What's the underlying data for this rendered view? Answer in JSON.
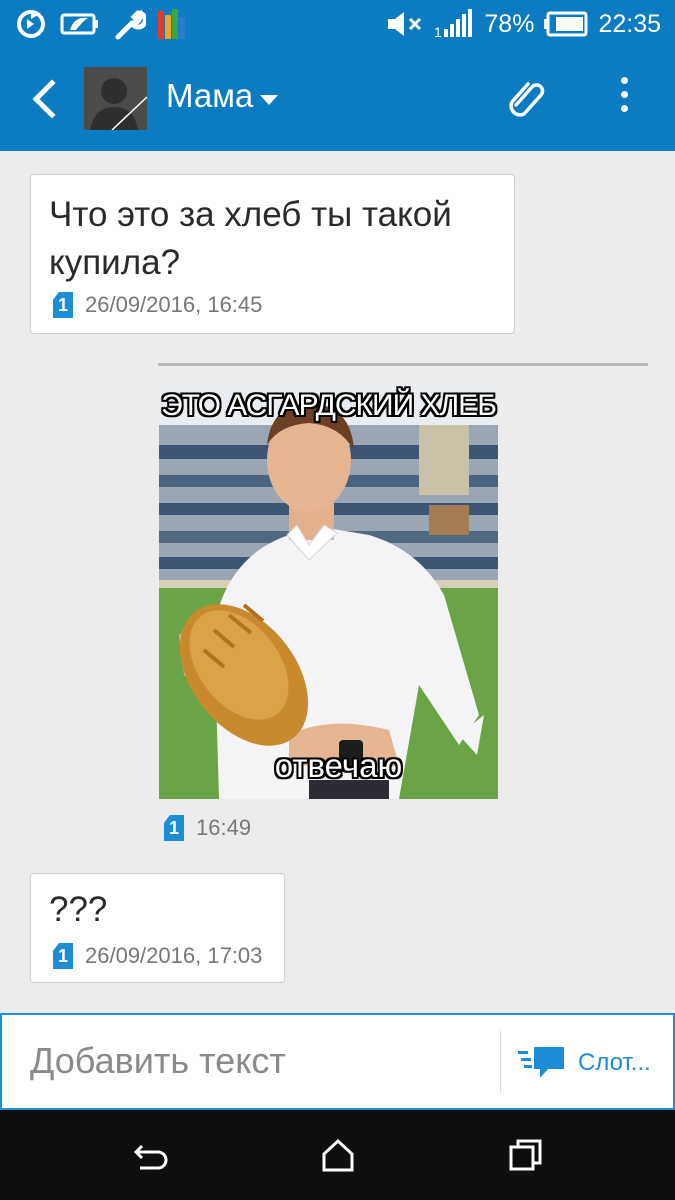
{
  "status_bar": {
    "battery": "78%",
    "time": "22:35",
    "icons": [
      "sync-icon",
      "battery-saver-icon",
      "wrench-icon",
      "avg-antivirus-icon",
      "mute-icon",
      "signal-icon",
      "battery-icon"
    ]
  },
  "app_bar": {
    "contact_name": "Мама",
    "back_icon": "back-arrow-icon",
    "attach_icon": "paperclip-icon",
    "menu_icon": "more-vertical-icon"
  },
  "messages": [
    {
      "text": "Что это за хлеб ты такой купила?",
      "sim": "1",
      "timestamp": "26/09/2016, 16:45"
    },
    {
      "type": "image",
      "caption_top": "ЭТО АСГАРДСКИЙ ХЛЕБ",
      "caption_bottom": "отвечаю",
      "sim": "1",
      "timestamp": "16:49"
    },
    {
      "text": "???",
      "sim": "1",
      "timestamp": "26/09/2016, 17:03"
    }
  ],
  "compose": {
    "placeholder": "Добавить текст",
    "send_label": "Слот..."
  },
  "nav_bar": {
    "icons": [
      "nav-back-icon",
      "nav-home-icon",
      "nav-recents-icon"
    ]
  },
  "colors": {
    "app_bar": "#0b7cc2",
    "accent": "#1d8dd6",
    "background": "#ececec"
  }
}
